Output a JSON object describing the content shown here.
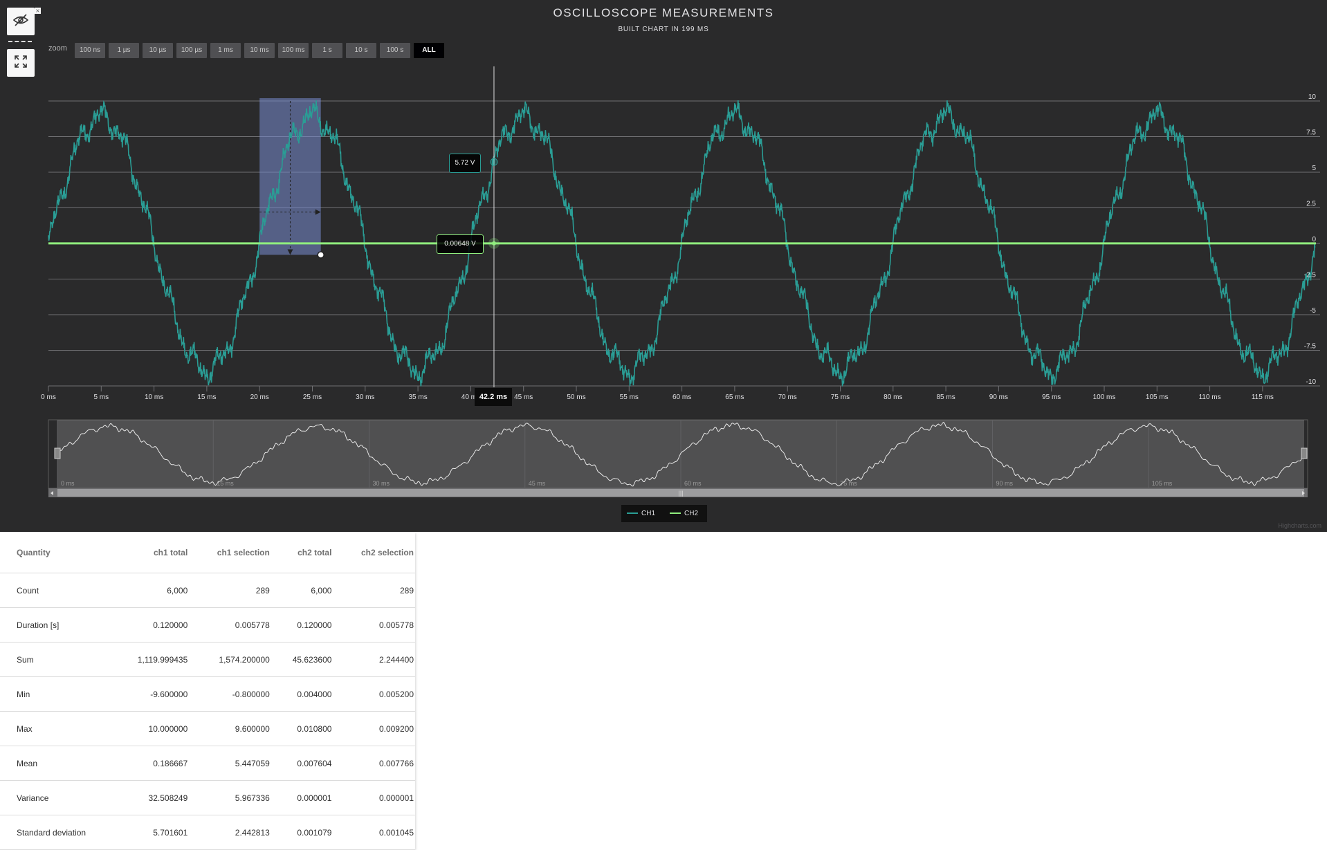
{
  "chart_data": {
    "type": "line",
    "title": "OSCILLOSCOPE MEASUREMENTS",
    "subtitle": "BUILT CHART IN 199 MS",
    "zoom_label": "zoom",
    "range_buttons": [
      "100 ns",
      "1 µs",
      "10 µs",
      "100 µs",
      "1 ms",
      "10 ms",
      "100 ms",
      "1 s",
      "10 s",
      "100 s",
      "ALL"
    ],
    "active_button": "ALL",
    "x_axis": {
      "unit": "ms",
      "range": [
        0,
        120
      ],
      "tick_step": 5,
      "tick_labels": [
        "0 ms",
        "5 ms",
        "10 ms",
        "15 ms",
        "20 ms",
        "25 ms",
        "30 ms",
        "35 ms",
        "40 ms",
        "45 ms",
        "50 ms",
        "55 ms",
        "60 ms",
        "65 ms",
        "70 ms",
        "75 ms",
        "80 ms",
        "85 ms",
        "90 ms",
        "95 ms",
        "100 ms",
        "105 ms",
        "110 ms",
        "115 ms"
      ]
    },
    "y_axis": {
      "range": [
        -10,
        10
      ],
      "tick_labels": [
        "10",
        "7.5",
        "5",
        "2.5",
        "0",
        "-2.5",
        "-5",
        "-7.5",
        "-10"
      ],
      "opposite": true
    },
    "series": [
      {
        "name": "CH1",
        "color": "#2a9d95",
        "waveform": "sine with harmonics",
        "period_ms": 20,
        "amplitude_v": 9.6,
        "points": 6000
      },
      {
        "name": "CH2",
        "color": "#90ee7e",
        "waveform": "flat",
        "level_v": 0.0076,
        "points": 6000
      }
    ],
    "selection": {
      "x_from_ms": 20,
      "x_to_ms": 25.8,
      "y_from_v": 10,
      "y_to_v": -0.8
    },
    "crosshair": {
      "x_label": "42.2 ms",
      "ch1_value": "5.72 V",
      "ch2_value": "0.00648 V"
    },
    "navigator": {
      "tick_labels": [
        "0 ms",
        "15 ms",
        "30 ms",
        "45 ms",
        "60 ms",
        "75 ms",
        "90 ms",
        "105 ms"
      ]
    },
    "legend": [
      "CH1",
      "CH2"
    ],
    "grid": true,
    "credits": "Highcharts.com"
  },
  "stats": {
    "headers": [
      "Quantity",
      "ch1 total",
      "ch1 selection",
      "ch2 total",
      "ch2 selection"
    ],
    "rows": [
      [
        "Count",
        "6,000",
        "289",
        "6,000",
        "289"
      ],
      [
        "Duration [s]",
        "0.120000",
        "0.005778",
        "0.120000",
        "0.005778"
      ],
      [
        "Sum",
        "1,119.999435",
        "1,574.200000",
        "45.623600",
        "2.244400"
      ],
      [
        "Min",
        "-9.600000",
        "-0.800000",
        "0.004000",
        "0.005200"
      ],
      [
        "Max",
        "10.000000",
        "9.600000",
        "0.010800",
        "0.009200"
      ],
      [
        "Mean",
        "0.186667",
        "5.447059",
        "0.007604",
        "0.007766"
      ],
      [
        "Variance",
        "32.508249",
        "5.967336",
        "0.000001",
        "0.000001"
      ],
      [
        "Standard deviation",
        "5.701601",
        "2.442813",
        "0.001079",
        "0.001045"
      ]
    ]
  },
  "toolbar": {
    "hide_icon": "eye-slash-icon",
    "fullscreen_icon": "expand-icon",
    "close_icon": "close-icon",
    "close_glyph": "×"
  }
}
